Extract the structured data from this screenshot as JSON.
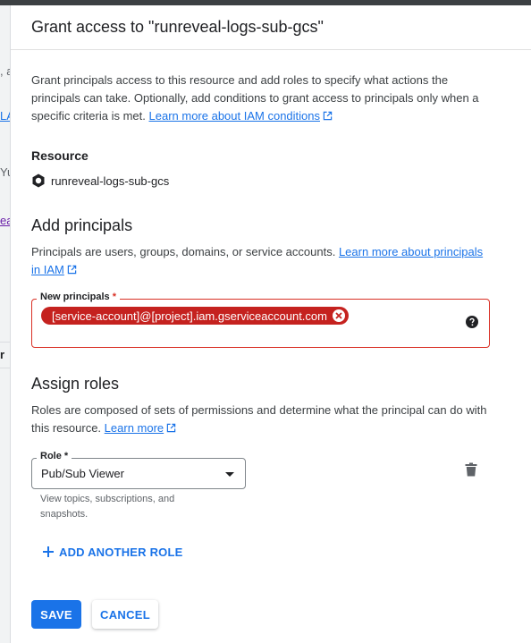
{
  "background": {
    "fragments": [
      ", a",
      "LA",
      "Yu",
      "eal",
      "r"
    ]
  },
  "panel": {
    "title": "Grant access to \"runreveal-logs-sub-gcs\"",
    "intro_text": "Grant principals access to this resource and add roles to specify what actions the principals can take. Optionally, add conditions to grant access to principals only when a specific criteria is met.",
    "intro_link": "Learn more about IAM conditions"
  },
  "resource": {
    "heading": "Resource",
    "name": "runreveal-logs-sub-gcs",
    "icon": "pubsub-icon"
  },
  "add_principals": {
    "heading": "Add principals",
    "description": "Principals are users, groups, domains, or service accounts.",
    "link": "Learn more about principals in IAM",
    "field_label": "New principals",
    "required_mark": "*",
    "chip_value": "[service-account]@[project].iam.gserviceaccount.com",
    "error_color": "#d93025"
  },
  "assign_roles": {
    "heading": "Assign roles",
    "description": "Roles are composed of sets of permissions and determine what the principal can do with this resource.",
    "link": "Learn more",
    "role_label": "Role",
    "required_mark": "*",
    "role_value": "Pub/Sub Viewer",
    "role_hint": "View topics, subscriptions, and snapshots.",
    "add_role_label": "ADD ANOTHER ROLE"
  },
  "actions": {
    "save_label": "SAVE",
    "cancel_label": "CANCEL",
    "accent_color": "#1a73e8"
  }
}
